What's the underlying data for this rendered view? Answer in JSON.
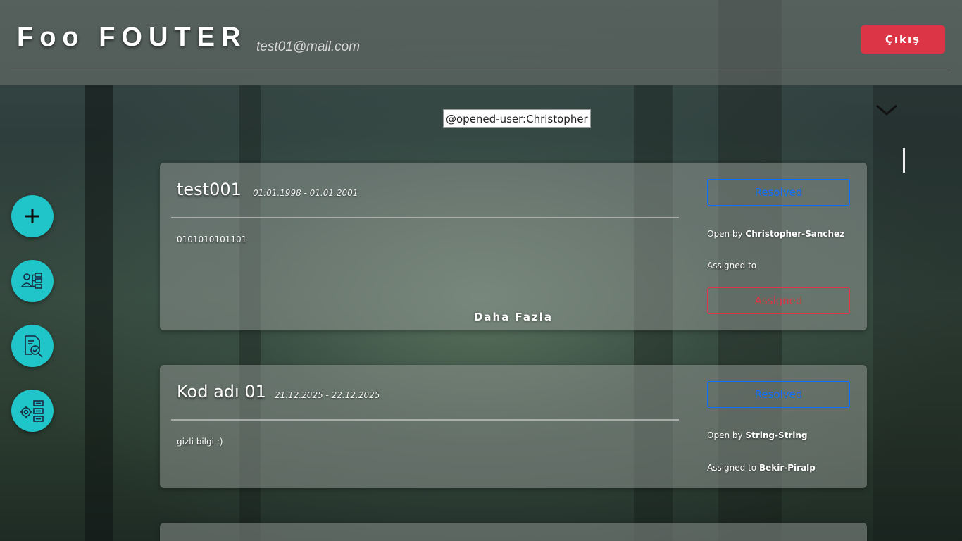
{
  "header": {
    "brand": "Foo FOUTER",
    "email": "test01@mail.com",
    "logout_label": "Çıkış"
  },
  "tooltip": "@opened-user:Christopher",
  "side_actions": [
    {
      "icon": "plus-icon"
    },
    {
      "icon": "user-hierarchy-icon"
    },
    {
      "icon": "document-search-icon"
    },
    {
      "icon": "settings-list-icon"
    }
  ],
  "cards": [
    {
      "title": "test001",
      "dates": "01.01.1998 - 01.01.2001",
      "description": "0101010101101",
      "status_label": "Resolved",
      "open_by_prefix": "Open by",
      "open_by": "Christopher-Sanchez",
      "assigned_prefix": "Assigned to",
      "assigned_to": "",
      "assign_button": "Assigned",
      "more_label": "Daha Fazla"
    },
    {
      "title": "Kod adı 01",
      "dates": "21.12.2025 - 22.12.2025",
      "description": "gizli bilgi ;)",
      "status_label": "Resolved",
      "open_by_prefix": "Open by",
      "open_by": "String-String",
      "assigned_prefix": "Assigned to",
      "assigned_to": "Bekir-Piralp"
    }
  ],
  "colors": {
    "accent": "#1fc5c8",
    "danger": "#dc3545",
    "primary": "#0d6efd"
  }
}
